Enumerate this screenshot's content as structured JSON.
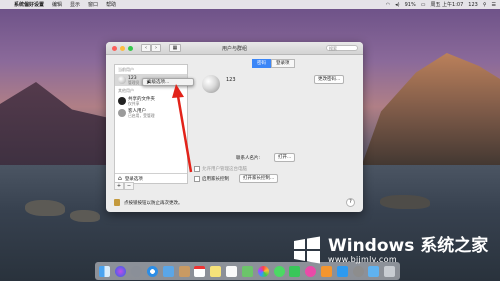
{
  "menubar": {
    "app_name": "系统偏好设置",
    "items": [
      "编辑",
      "显示",
      "窗口",
      "帮助"
    ],
    "battery": "91%",
    "clock": "周五 上午1:07",
    "user": "123"
  },
  "window": {
    "title": "用户与群组",
    "search_placeholder": "搜索"
  },
  "sidebar": {
    "current_users_label": "当前用户",
    "current_user": {
      "name": "123",
      "role": "管理员"
    },
    "other_users_label": "其他用户",
    "other_users": [
      {
        "name": "共享的文件夹",
        "role": "仅共享"
      },
      {
        "name": "客人用户",
        "role": "已启用，受管理"
      }
    ],
    "login_options": "登录选项",
    "add": "+",
    "remove": "−"
  },
  "context_menu": {
    "item": "高级选项..."
  },
  "tabs": [
    {
      "label": "密码",
      "active": true
    },
    {
      "label": "登录项",
      "active": false
    }
  ],
  "pane": {
    "user_name": "123",
    "change_password": "更改密码...",
    "contact_card_label": "联系人名片:",
    "open_button": "打开...",
    "allow_admin": "允许用户管理这台电脑",
    "parental_controls": "启用家长控制",
    "open_parental": "打开家长控制..."
  },
  "lock_text": "点按锁按钮以防止再次更改。",
  "help": "?",
  "watermark": {
    "title": "Windows 系统之家",
    "url": "www.bjjmlv.com"
  },
  "colors": {
    "accent": "#3b86f7",
    "arrow": "#e2231a"
  }
}
